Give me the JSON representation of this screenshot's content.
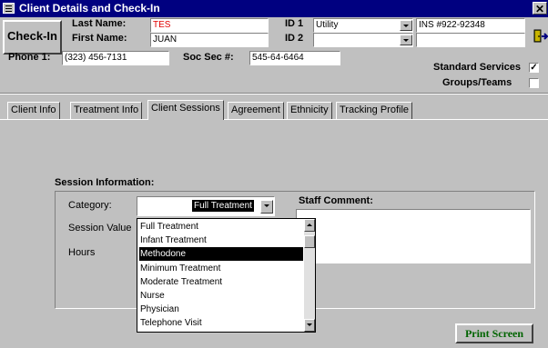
{
  "window": {
    "title": "Client Details and Check-In",
    "close_glyph": "✕"
  },
  "header": {
    "checkin_label": "Check-In",
    "last_name_label": "Last Name:",
    "last_name_value": "TES",
    "first_name_label": "First Name:",
    "first_name_value": "JUAN",
    "id1_label": "ID 1",
    "id1_value": "Utility",
    "id1_extra": "INS #922-92348",
    "id2_label": "ID 2",
    "id2_value": "",
    "id2_extra": "",
    "phone_label": "Phone 1:",
    "phone_value": "(323) 456-7131",
    "ssn_label": "Soc Sec #:",
    "ssn_value": "545-64-6464",
    "standard_services_label": "Standard Services",
    "standard_services_checked": true,
    "groups_label": "Groups/Teams",
    "groups_checked": false
  },
  "tabs": [
    {
      "label": "Client Info"
    },
    {
      "label": "Treatment Info"
    },
    {
      "label": "Client Sessions",
      "active": true
    },
    {
      "label": "Agreement"
    },
    {
      "label": "Ethnicity"
    },
    {
      "label": "Tracking Profile"
    }
  ],
  "session": {
    "heading": "Session Information:",
    "category_label": "Category:",
    "category_value": "Full Treatment",
    "session_value_label": "Session Value",
    "hours_label": "Hours",
    "staff_comment_label": "Staff Comment:",
    "category_options": [
      "Full Treatment",
      "Infant Treatment",
      "Methodone",
      "Minimum Treatment",
      "Moderate Treatment",
      "Nurse",
      "Physician",
      "Telephone Visit"
    ],
    "selected_option_index": 2
  },
  "footer": {
    "print_label": "Print Screen"
  },
  "colors": {
    "title_bar": "#000080",
    "face": "#c0c0c0",
    "accent_red": "#e00000",
    "print_green": "#006400"
  }
}
